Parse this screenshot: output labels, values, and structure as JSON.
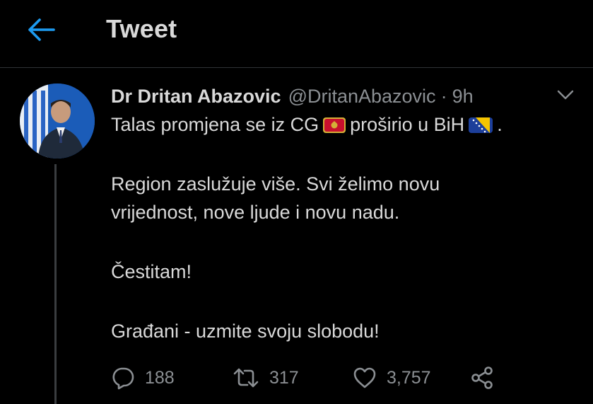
{
  "header": {
    "title": "Tweet",
    "back_icon": "arrow-left-icon",
    "accent": "#1d9bf0"
  },
  "tweet": {
    "display_name": "Dr Dritan Abazovic",
    "handle": "@DritanAbazovic",
    "separator": "·",
    "time": "9h",
    "text": {
      "line1_a": "Talas promjena se iz CG",
      "line1_b": "proširio u BiH",
      "line1_c": ".",
      "line2": "Region zaslužuje više. Svi želimo novu",
      "line3": "vrijednost, nove ljude i novu nadu.",
      "line4": "Čestitam!",
      "line5": "Građani - uzmite svoju slobodu!"
    },
    "flags": [
      "montenegro-flag-emoji",
      "bosnia-flag-emoji"
    ]
  },
  "actions": {
    "reply_count": "188",
    "retweet_count": "317",
    "like_count": "3,757"
  },
  "colors": {
    "background": "#000000",
    "text": "#d9d9d9",
    "muted": "#8b8f93"
  }
}
